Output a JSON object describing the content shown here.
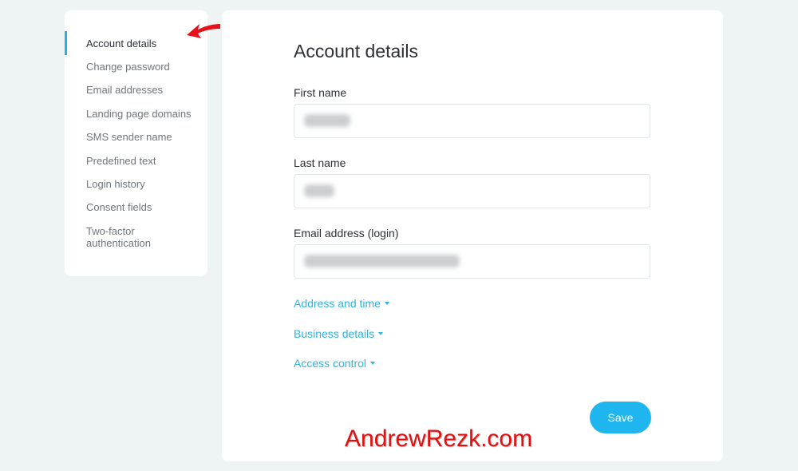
{
  "sidebar": {
    "items": [
      {
        "label": "Account details",
        "active": true
      },
      {
        "label": "Change password"
      },
      {
        "label": "Email addresses"
      },
      {
        "label": "Landing page domains"
      },
      {
        "label": "SMS sender name"
      },
      {
        "label": "Predefined text"
      },
      {
        "label": "Login history"
      },
      {
        "label": "Consent fields"
      },
      {
        "label": "Two-factor authentication"
      }
    ]
  },
  "main": {
    "title": "Account details",
    "fields": [
      {
        "label": "First name",
        "value": "[blurred]"
      },
      {
        "label": "Last name",
        "value": "[blurred]"
      },
      {
        "label": "Email address (login)",
        "value": "[blurred]"
      }
    ],
    "sections": [
      {
        "label": "Address and time"
      },
      {
        "label": "Business details"
      },
      {
        "label": "Access control"
      }
    ],
    "save_label": "Save"
  },
  "annotations": {
    "watermark": "AndrewRezk.com",
    "arrow_color": "#e8101a"
  },
  "colors": {
    "accent": "#1fb5ef",
    "link": "#2cb5e0",
    "background": "#eef3f3"
  }
}
